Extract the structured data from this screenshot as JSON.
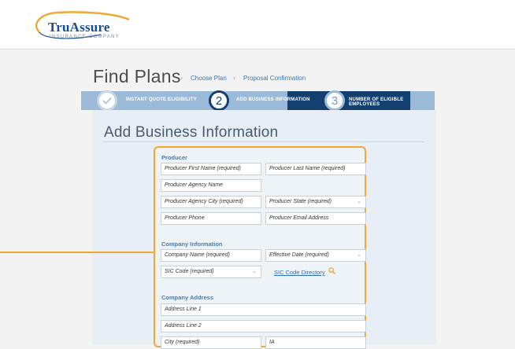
{
  "brand": {
    "name": "TruAssure",
    "tagline": "INSURANCE COMPANY"
  },
  "page": {
    "title": "Find Plans",
    "breadcrumbs": [
      "Choose Plan",
      "Proposal Confirmation"
    ],
    "breadcrumb_separator": "›"
  },
  "steps": [
    {
      "number": "✓",
      "label": "INSTANT QUOTE ELIGIBILITY"
    },
    {
      "number": "2",
      "label": "ADD BUSINESS INFORMATION"
    },
    {
      "number": "3",
      "label": "NUMBER OF ELIGIBLE EMPLOYEES"
    }
  ],
  "form": {
    "heading": "Add Business Information",
    "producer": {
      "label": "Producer",
      "first_name": "Producer First Name (required)",
      "last_name": "Producer Last Name (required)",
      "agency_name": "Producer Agency Name",
      "agency_city": "Producer Agency City (required)",
      "state": "Producer State (required)",
      "phone": "Producer Phone",
      "email": "Producer Email Address"
    },
    "company": {
      "label": "Company Information",
      "name": "Company Name (required)",
      "effective_date": "Effective Date (required)",
      "sic_code": "SIC Code (required)",
      "sic_link": "SIC Code Directory"
    },
    "address": {
      "label": "Company Address",
      "line1": "Address Line 1",
      "line2": "Address Line 2",
      "city": "City (required)",
      "state": "IA"
    }
  },
  "icons": {
    "dropdown": "chevron-down-icon",
    "search": "search-icon",
    "check": "check-icon"
  },
  "colors": {
    "brand_blue": "#1a4d8c",
    "step_active": "#14406f",
    "step_bar": "#9bbad7",
    "highlight": "#f0a830",
    "link": "#2a6fc0"
  }
}
